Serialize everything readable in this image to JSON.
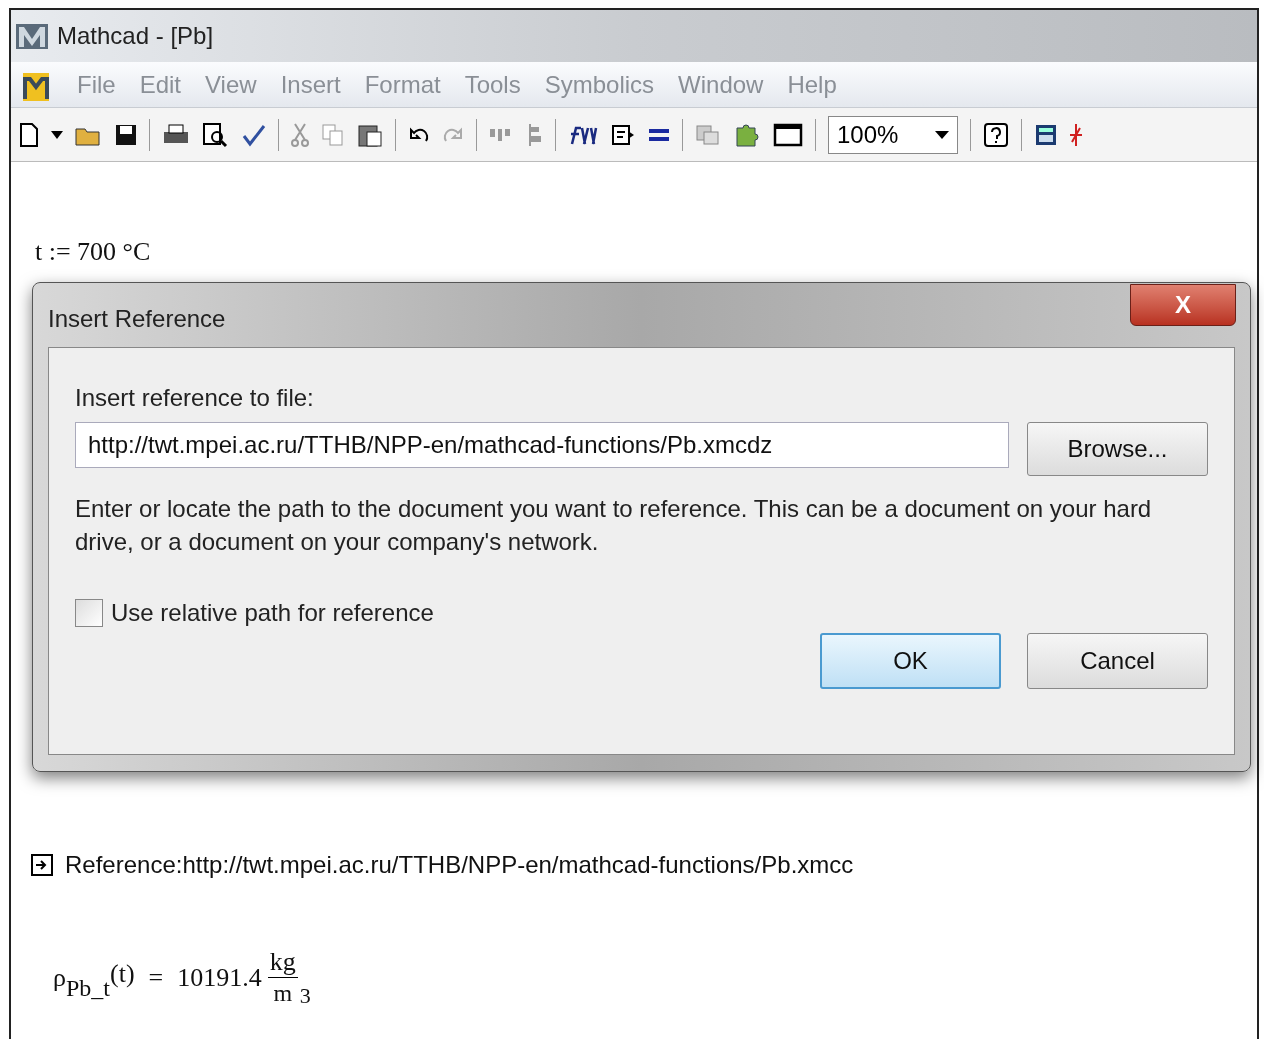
{
  "window": {
    "title": "Mathcad - [Pb]"
  },
  "menu": [
    "File",
    "Edit",
    "View",
    "Insert",
    "Format",
    "Tools",
    "Symbolics",
    "Window",
    "Help"
  ],
  "toolbar": {
    "zoom": "100%"
  },
  "document": {
    "definition": "t := 700 °C",
    "reference": "Reference:http://twt.mpei.ac.ru/TTHB/NPP-en/mathcad-functions/Pb.xmcc",
    "result": {
      "symbol": "ρ",
      "subscript": "Pb_t",
      "argument": "(t)",
      "operator": "=",
      "value": "10191.4",
      "unit_numerator": "kg",
      "unit_denominator": "m",
      "unit_exponent": "3"
    }
  },
  "dialog": {
    "title": "Insert Reference",
    "close": "X",
    "field_label": "Insert reference to file:",
    "path": "http://twt.mpei.ac.ru/TTHB/NPP-en/mathcad-functions/Pb.xmcdz",
    "browse": "Browse...",
    "description": "Enter or locate the path to the document you want to reference. This can be a document on your hard drive, or a document on your company's network.",
    "relative_path": {
      "label": "Use relative path for reference",
      "checked": false
    },
    "buttons": [
      {
        "label": "OK",
        "default": true
      },
      {
        "label": "Cancel",
        "default": false
      }
    ]
  }
}
